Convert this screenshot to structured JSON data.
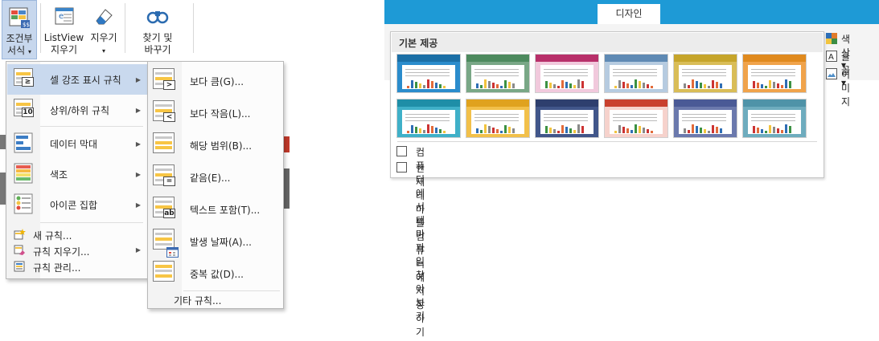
{
  "ribbon": {
    "conditional_format": {
      "line1": "조건부",
      "line2": "서식",
      "caret": "▾"
    },
    "listview": {
      "line1": "ListView",
      "line2": "지우기"
    },
    "erase": {
      "line1": "지우기",
      "caret": "▾"
    },
    "find_replace": {
      "line1": "찾기 및",
      "line2": "바꾸기"
    }
  },
  "cf_menu": {
    "items": [
      {
        "label": "셀 강조 표시 규칙",
        "has_submenu": true,
        "highlighted": true
      },
      {
        "label": "상위/하위 규칙",
        "has_submenu": true
      },
      {
        "label": "데이터 막대",
        "has_submenu": true
      },
      {
        "label": "색조",
        "has_submenu": true
      },
      {
        "label": "아이콘 집합",
        "has_submenu": true
      }
    ],
    "small_items": [
      {
        "label": "새 규칙..."
      },
      {
        "label": "규칙 지우기...",
        "has_submenu": true
      },
      {
        "label": "규칙 관리..."
      }
    ],
    "arrow": "▶"
  },
  "highlight_submenu": {
    "items": [
      {
        "label": "보다 큼(G)...",
        "badge": ">"
      },
      {
        "label": "보다 작음(L)...",
        "badge": "<"
      },
      {
        "label": "해당 범위(B)...",
        "badge": ""
      },
      {
        "label": "같음(E)...",
        "badge": "="
      },
      {
        "label": "텍스트 포함(T)...",
        "badge": "ab"
      },
      {
        "label": "발생 날짜(A)...",
        "badge": ""
      },
      {
        "label": "중복 값(D)...",
        "badge": ""
      }
    ],
    "more": "기타 규칙..."
  },
  "design": {
    "tab": "디자인",
    "gallery_title": "기본 제공",
    "themes": [
      {
        "head": "#1b6fa6",
        "body": "#2b8ccc"
      },
      {
        "head": "#4d8a5e",
        "body": "#79a786"
      },
      {
        "head": "#b8306a",
        "body": "#f1c9dc"
      },
      {
        "head": "#5f8ab4",
        "body": "#b6cbe0"
      },
      {
        "head": "#c6a52b",
        "body": "#d9bd57"
      },
      {
        "head": "#e08a1e",
        "body": "#f0a34b"
      },
      {
        "head": "#1e8ea7",
        "body": "#3fb0c8"
      },
      {
        "head": "#e0a21e",
        "body": "#f2c04a"
      },
      {
        "head": "#2e3f6e",
        "body": "#41568a"
      },
      {
        "head": "#c9402e",
        "body": "#f6d2cc"
      },
      {
        "head": "#4a5a96",
        "body": "#6b79ad"
      },
      {
        "head": "#4f93a8",
        "body": "#6eacbe"
      }
    ],
    "gallery_actions": [
      {
        "label": "컴퓨터에서 테마 파일 찾아보기"
      },
      {
        "label": "현재 테마를 컴퓨터에 저장하기"
      }
    ],
    "side_options": [
      {
        "label": "색상 ▾"
      },
      {
        "label": "글꼴 ▾"
      },
      {
        "label": "이미지"
      }
    ]
  }
}
